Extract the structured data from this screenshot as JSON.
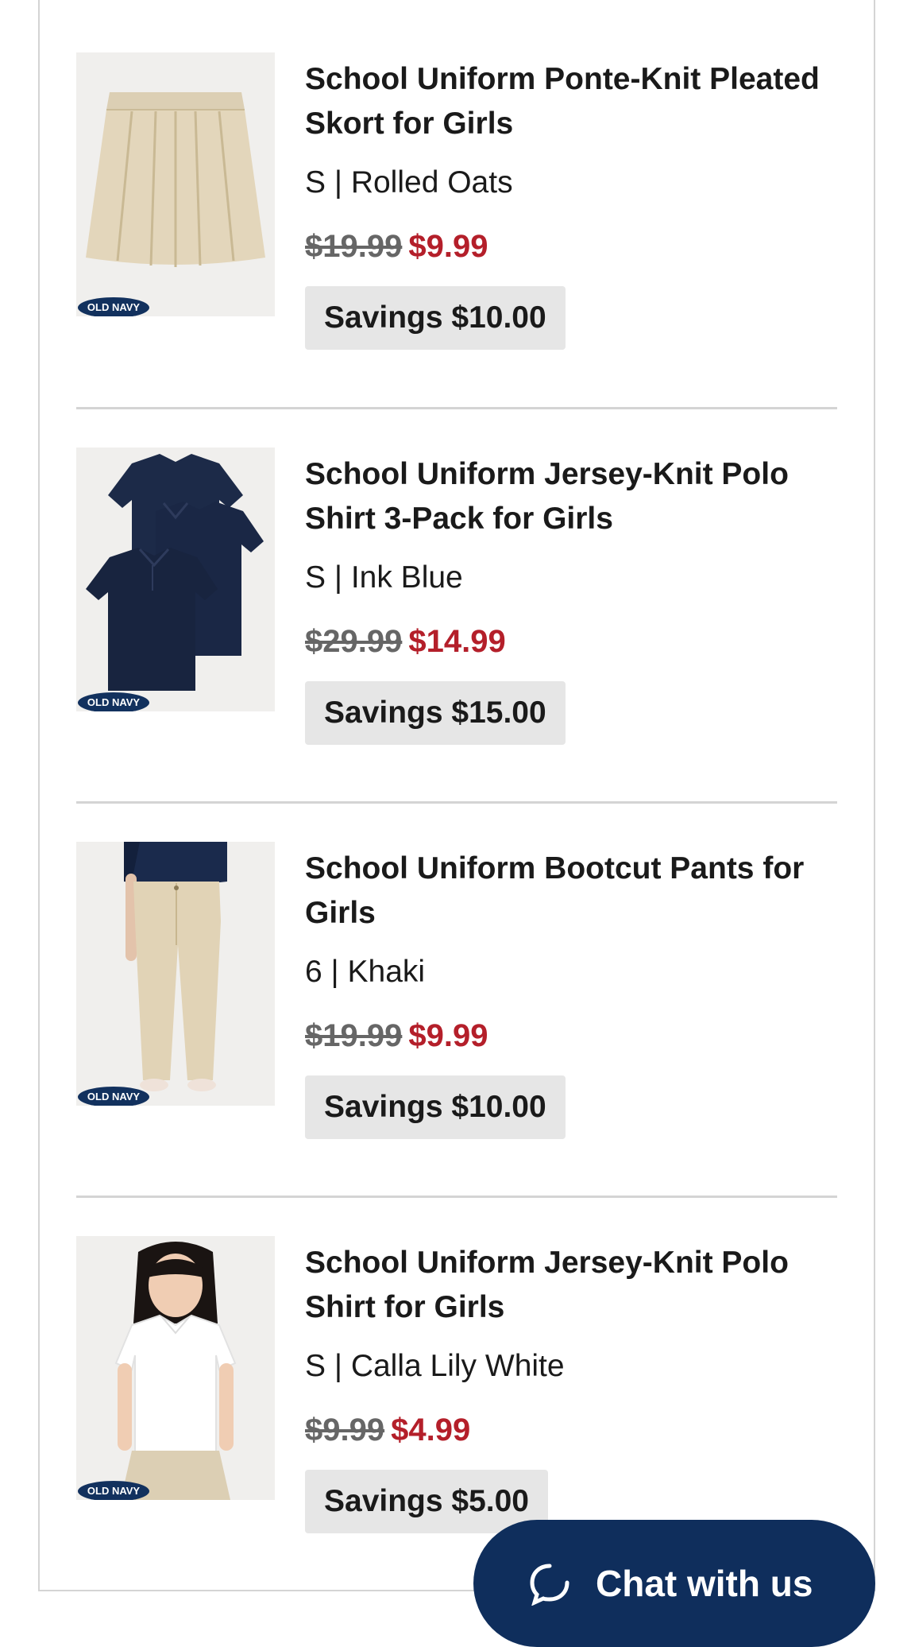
{
  "brand": "OLD NAVY",
  "items": [
    {
      "name": "School Uniform Ponte-Knit Pleated Skort for Girls",
      "variant": "S | Rolled Oats",
      "old_price": "$19.99",
      "new_price": "$9.99",
      "savings": "Savings $10.00",
      "thumbnail_icon": "skort-icon"
    },
    {
      "name": "School Uniform Jersey-Knit Polo Shirt 3-Pack for Girls",
      "variant": "S | Ink Blue",
      "old_price": "$29.99",
      "new_price": "$14.99",
      "savings": "Savings $15.00",
      "thumbnail_icon": "polo-shirts-icon"
    },
    {
      "name": "School Uniform Bootcut Pants for Girls",
      "variant": "6 | Khaki",
      "old_price": "$19.99",
      "new_price": "$9.99",
      "savings": "Savings $10.00",
      "thumbnail_icon": "pants-icon"
    },
    {
      "name": "School Uniform Jersey-Knit Polo Shirt for Girls",
      "variant": "S | Calla Lily White",
      "old_price": "$9.99",
      "new_price": "$4.99",
      "savings": "Savings $5.00",
      "thumbnail_icon": "girl-polo-icon"
    }
  ],
  "chat": {
    "label": "Chat with us",
    "icon": "chat-bubble-icon"
  },
  "colors": {
    "sale_price": "#b41f2a",
    "old_price": "#666666",
    "brand_navy": "#0f2e5c",
    "savings_bg": "#e6e6e6"
  }
}
